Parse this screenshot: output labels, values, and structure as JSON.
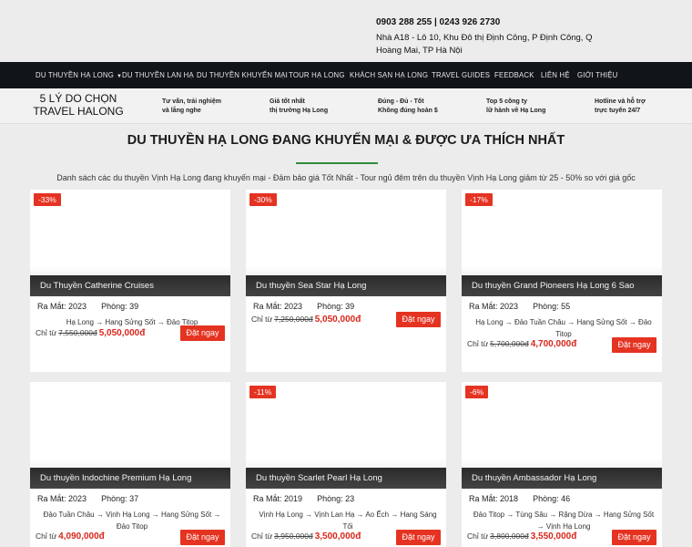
{
  "topbar": {
    "phone": "0903 288 255 | 0243 926 2730",
    "address": "Nhà A18 - Lô 10, Khu Đô thị Định Công, P Định Công, Q Hoàng Mai, TP Hà Nội"
  },
  "nav": {
    "items": [
      "DU THUYỀN HẠ LONG",
      "DU THUYỀN LAN HẠ",
      "DU THUYỀN KHUYẾN MẠI",
      "TOUR HẠ LONG",
      "KHÁCH SẠN HẠ LONG",
      "TRAVEL GUIDES",
      "FEEDBACK",
      "LIÊN HỆ",
      "GIỚI THIỆU"
    ],
    "caret": "▼"
  },
  "reasons": {
    "brand_line1": "5 LÝ DO CHỌN",
    "brand_line2": "TRAVEL HALONG",
    "items": [
      {
        "l1": "Tư vấn, trải nghiệm",
        "l2": "và lắng nghe"
      },
      {
        "l1": "Giá tốt nhất",
        "l2": "thị trường Hạ Long"
      },
      {
        "l1": "Đúng - Đủ - Tốt",
        "l2": "Không đúng hoàn $"
      },
      {
        "l1": "Top 5 công ty",
        "l2": "lữ hành về Hạ Long"
      },
      {
        "l1": "Hotline và hỗ trợ",
        "l2": "trực tuyến 24/7"
      }
    ]
  },
  "main": {
    "heading": "DU THUYỀN HẠ LONG ĐANG KHUYẾN MẠI & ĐƯỢC ƯA THÍCH NHẤT",
    "subtitle": "Danh sách các du thuyền Vịnh Hạ Long đang khuyến mại - Đảm bảo giá Tốt Nhất - Tour ngủ đêm trên du thuyền Vịnh Hạ Long giảm từ 25 - 50% so với giá gốc"
  },
  "labels": {
    "launch": "Ra Mắt:",
    "rooms": "Phòng:",
    "from": "Chỉ từ",
    "book": "Đặt ngay"
  },
  "cards": [
    {
      "discount": "-33%",
      "title": "Du Thuyền Catherine Cruises",
      "year": "2023",
      "rooms": "39",
      "route": "Hạ Long → Hang Sửng Sốt → Đảo Titop",
      "old": "7,550,000đ",
      "new": "5,050,000đ"
    },
    {
      "discount": "-30%",
      "title": "Du thuyền Sea Star Hạ Long",
      "year": "2023",
      "rooms": "39",
      "route": "",
      "old": "7,250,000đ",
      "new": "5,050,000đ"
    },
    {
      "discount": "-17%",
      "title": "Du thuyền Grand Pioneers Hạ Long 6 Sao",
      "year": "2023",
      "rooms": "55",
      "route": "Hạ Long → Đảo Tuần Châu → Hang Sửng Sốt → Đảo Titop",
      "old": "5,700,000đ",
      "new": "4,700,000đ"
    },
    {
      "discount": "",
      "title": "Du thuyền Indochine Premium Hạ Long",
      "year": "2023",
      "rooms": "37",
      "route": "Đảo Tuần Châu → Vịnh Hạ Long → Hang Sửng Sốt → Đảo Titop",
      "old": "",
      "new": "4,090,000đ"
    },
    {
      "discount": "-11%",
      "title": "Du thuyền Scarlet Pearl Hạ Long",
      "year": "2019",
      "rooms": "23",
      "route": "Vịnh Hạ Long → Vịnh Lan Hạ → Ao Ếch → Hang Sáng Tối",
      "old": "3,950,000đ",
      "new": "3,500,000đ"
    },
    {
      "discount": "-6%",
      "title": "Du thuyền Ambassador Hạ Long",
      "year": "2018",
      "rooms": "46",
      "route": "Đảo Titop → Tùng Sâu → Rặng Dừa → Hang Sửng Sốt → Vịnh Hạ Long",
      "old": "3,800,000đ",
      "new": "3,550,000đ"
    }
  ]
}
